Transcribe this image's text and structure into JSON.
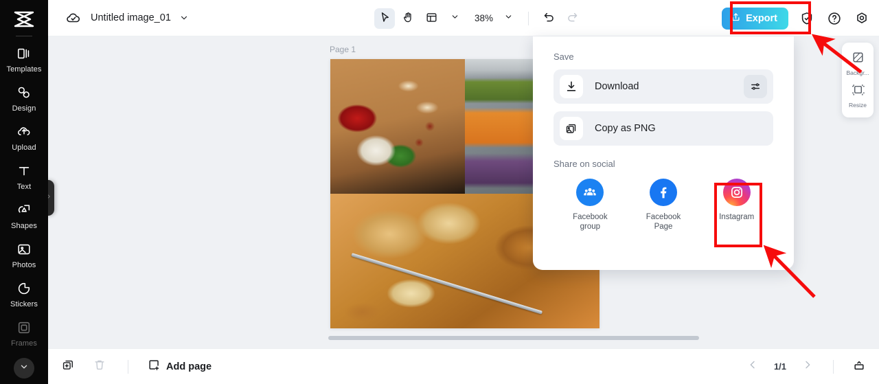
{
  "app": {
    "logo_icon": "app-logo-icon",
    "canvas_bg": "#eff1f4",
    "accent": "#3fd9e8",
    "annotation_color": "#f60c0c"
  },
  "sidebar": {
    "items": [
      {
        "label": "Templates",
        "icon": "templates-icon"
      },
      {
        "label": "Design",
        "icon": "design-icon"
      },
      {
        "label": "Upload",
        "icon": "upload-icon"
      },
      {
        "label": "Text",
        "icon": "text-icon"
      },
      {
        "label": "Shapes",
        "icon": "shapes-icon"
      },
      {
        "label": "Photos",
        "icon": "photos-icon"
      },
      {
        "label": "Stickers",
        "icon": "stickers-icon"
      },
      {
        "label": "Frames",
        "icon": "frames-icon"
      }
    ],
    "expand_icon": "chevron-down-icon",
    "panel_handle_icon": "chevron-right-icon"
  },
  "topbar": {
    "cloud_icon": "cloud-saved-icon",
    "document_title": "Untitled image_01",
    "title_chevron_icon": "chevron-down-icon",
    "tools": [
      {
        "name": "select-tool",
        "icon": "cursor-arrow-icon",
        "selected": true
      },
      {
        "name": "hand-tool",
        "icon": "hand-icon",
        "selected": false
      },
      {
        "name": "layout-tool",
        "icon": "layout-icon",
        "selected": false
      }
    ],
    "layout_chevron_icon": "chevron-down-icon",
    "zoom_level": "38%",
    "zoom_chevron_icon": "chevron-down-icon",
    "undo_icon": "undo-icon",
    "redo_icon": "redo-icon",
    "export_label": "Export",
    "export_icon": "upload-share-icon",
    "shield_icon": "shield-check-icon",
    "help_icon": "help-circle-icon",
    "settings_icon": "settings-gear-icon"
  },
  "canvas": {
    "page_label": "Page 1",
    "photos": [
      {
        "name": "photo-pepper-bread-garlic",
        "alt": "red pepper, flatbread, garlic and basil on wooden board"
      },
      {
        "name": "photo-buffet-trays",
        "alt": "buffet trays with shredded carrot and salads"
      },
      {
        "name": "photo-bread-loaves-knife",
        "alt": "bread loaves with bread knife and sliced baguette"
      }
    ],
    "scrollbar": "horizontal-scrollbar"
  },
  "right_panel": {
    "items": [
      {
        "label": "Backgr...",
        "icon": "background-icon"
      },
      {
        "label": "Resize",
        "icon": "resize-icon"
      }
    ]
  },
  "export_dropdown": {
    "save_heading": "Save",
    "rows": [
      {
        "label": "Download",
        "icon": "download-icon",
        "settings_icon": "sliders-icon",
        "has_settings": true
      },
      {
        "label": "Copy as PNG",
        "icon": "copy-image-icon",
        "has_settings": false
      }
    ],
    "share_heading": "Share on social",
    "socials": [
      {
        "label": "Facebook\ngroup",
        "line1": "Facebook",
        "line2": "group",
        "icon": "facebook-group-icon"
      },
      {
        "label": "Facebook\nPage",
        "line1": "Facebook",
        "line2": "Page",
        "icon": "facebook-page-icon"
      },
      {
        "label": "Instagram",
        "line1": "Instagram",
        "line2": "",
        "icon": "instagram-icon"
      }
    ]
  },
  "bottombar": {
    "duplicate_icon": "duplicate-page-icon",
    "delete_icon": "trash-icon",
    "add_page_label": "Add page",
    "add_page_icon": "add-page-icon",
    "prev_icon": "chevron-left-icon",
    "next_icon": "chevron-right-icon",
    "page_indicator": "1/1",
    "grid_icon": "page-grid-icon"
  },
  "annotations": {
    "export_highlight": "red-box-export",
    "instagram_highlight": "red-box-instagram",
    "arrow_to_export": "red-arrow-export",
    "arrow_to_instagram": "red-arrow-instagram"
  }
}
